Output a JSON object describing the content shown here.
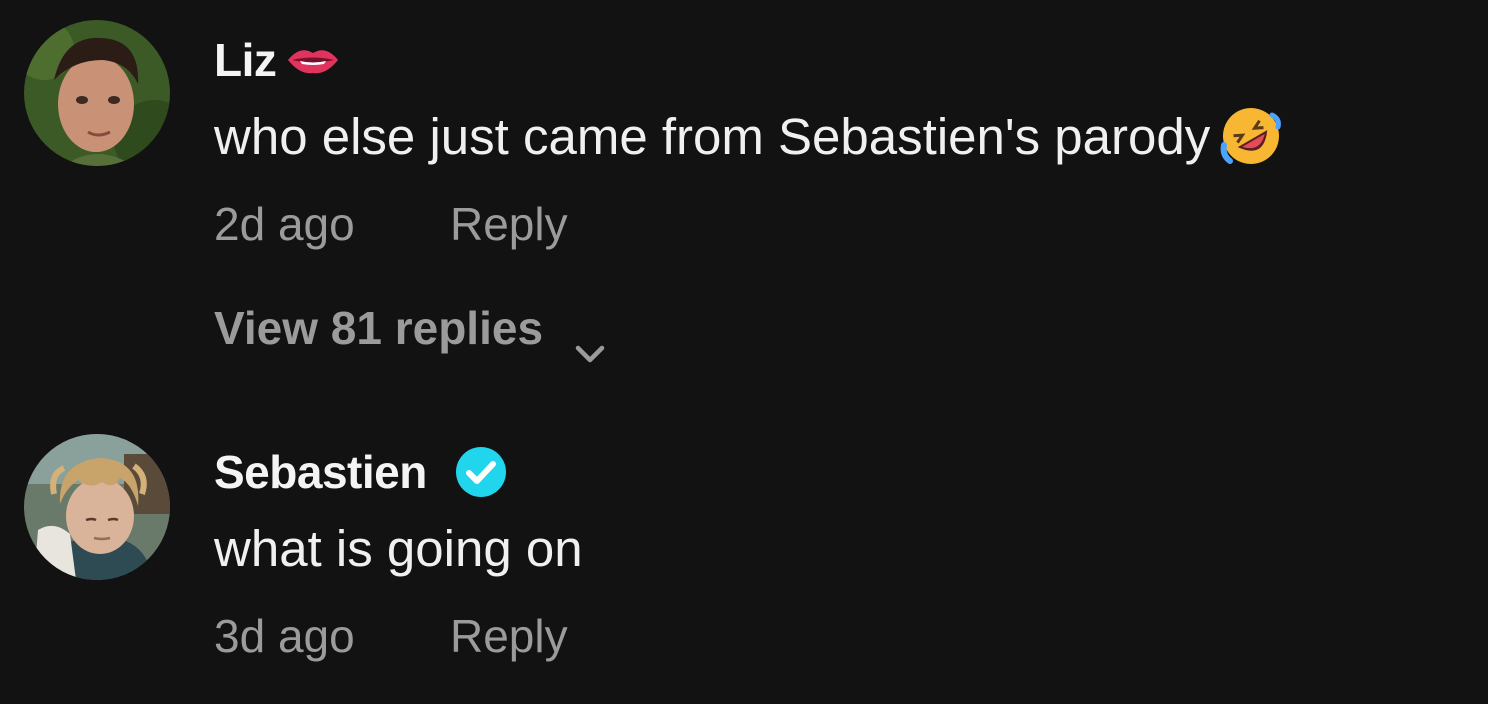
{
  "comments": [
    {
      "username": "Liz",
      "username_badge_icon": "lips-emoji-icon",
      "text": "who else just came from Sebastien's parody",
      "text_emoji_icon": "rolling-on-floor-laughing-emoji-icon",
      "time": "2d ago",
      "reply_label": "Reply",
      "view_replies_label": "View 81 replies",
      "view_replies_icon": "chevron-down-icon"
    },
    {
      "username": "Sebastien",
      "username_badge_icon": "verified-badge-icon",
      "text": "what is going on",
      "time": "3d ago",
      "reply_label": "Reply"
    }
  ],
  "colors": {
    "background": "#121212",
    "primary_text": "#f0f0f0",
    "secondary_text": "#9b9b9b",
    "verified_badge": "#20d5ec"
  }
}
